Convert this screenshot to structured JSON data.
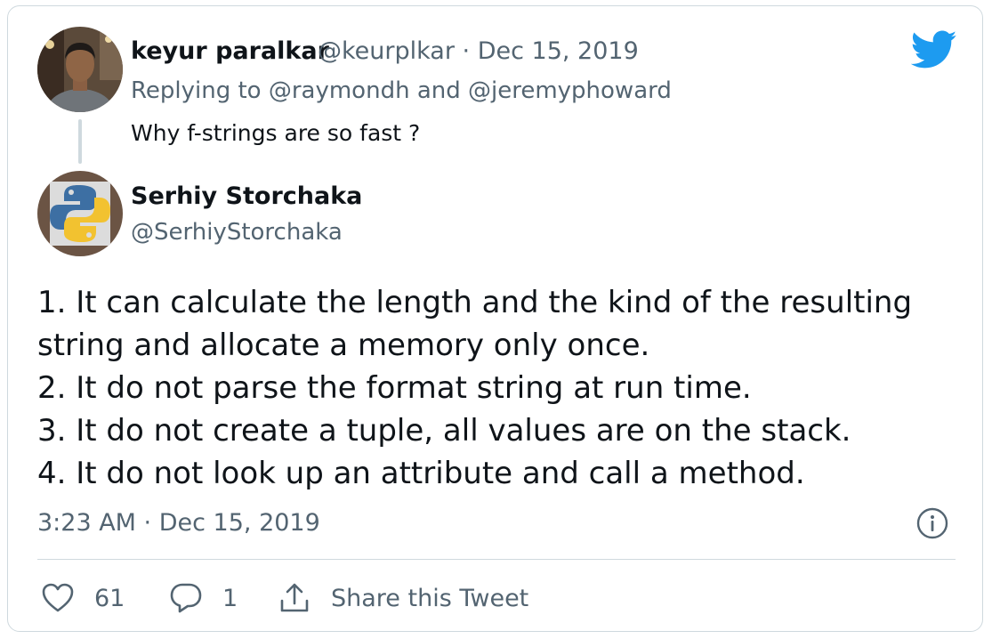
{
  "parent": {
    "name": "keyur paralkar",
    "handle_date": "@keurplkar · Dec 15, 2019",
    "replying": "Replying to @raymondh and @jeremyphoward",
    "text": "Why f-strings are so fast ?"
  },
  "reply": {
    "name": "Serhiy Storchaka",
    "handle": "@SerhiyStorchaka",
    "lines": [
      "1. It can calculate the length and the kind of the resulting",
      "string and allocate a memory only once.",
      "2. It do not parse the format string at run time.",
      "3. It do not create a tuple, all values are on the stack.",
      "4. It do not look up an attribute and call a method."
    ],
    "timestamp": "3:23 AM · Dec 15, 2019"
  },
  "actions": {
    "likes": "61",
    "replies": "1",
    "share_label": "Share this Tweet"
  },
  "colors": {
    "text": "#0f1419",
    "muted": "#536471",
    "brand": "#1d9bf0",
    "border": "#cfd9de"
  },
  "icons": {
    "brand": "twitter-bird-icon",
    "info": "info-icon",
    "like": "heart-icon",
    "reply": "reply-bubble-icon",
    "share": "share-icon"
  }
}
